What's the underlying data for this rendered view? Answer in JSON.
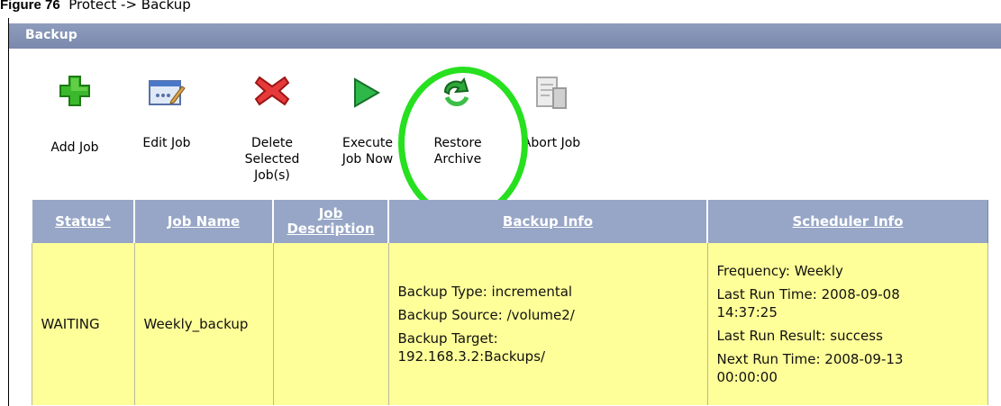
{
  "figure_caption": {
    "label": "Figure 76",
    "text": "Protect -> Backup"
  },
  "panel": {
    "title": "Backup"
  },
  "toolbar": [
    {
      "label": "Add Job",
      "icon": "add-icon"
    },
    {
      "label": "Edit Job",
      "icon": "edit-icon"
    },
    {
      "label": "Delete Selected Job(s)",
      "icon": "delete-icon"
    },
    {
      "label": "Execute Job Now",
      "icon": "execute-icon"
    },
    {
      "label": "Restore Archive",
      "icon": "restore-icon"
    },
    {
      "label": "Abort Job",
      "icon": "abort-icon"
    }
  ],
  "table": {
    "columns": [
      "Status",
      "Job Name",
      "Job Description",
      "Backup Info",
      "Scheduler Info"
    ],
    "rows": [
      {
        "status": "WAITING",
        "job_name": "Weekly_backup",
        "job_description": "",
        "backup_info": [
          "Backup Type: incremental",
          "Backup Source: /volume2/",
          "Backup Target: 192.168.3.2:Backups/"
        ],
        "scheduler_info": [
          "Frequency: Weekly",
          "Last Run Time: 2008-09-08 14:37:25",
          "Last Run Result: success",
          "Next Run Time: 2008-09-13 00:00:00"
        ]
      }
    ]
  },
  "colors": {
    "header_bar": "#7f8db0",
    "table_header": "#97a6c6",
    "row_bg": "#ffff99",
    "highlight_ring": "#27e01f"
  }
}
